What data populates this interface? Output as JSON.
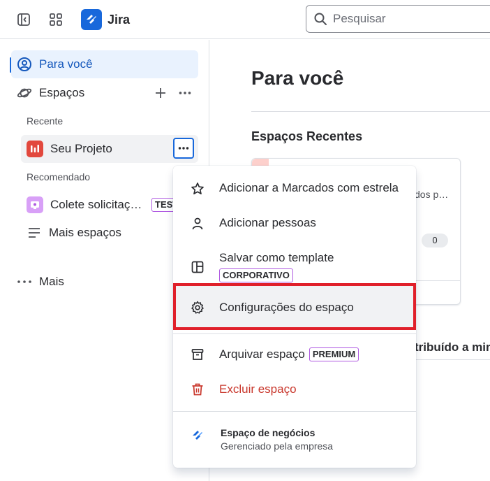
{
  "topbar": {
    "app_name": "Jira",
    "search_placeholder": "Pesquisar"
  },
  "sidebar": {
    "for_you": "Para você",
    "spaces": "Espaços",
    "recent_label": "Recente",
    "recent_project": "Seu Projeto",
    "recommended_label": "Recomendado",
    "recommended_item": "Colete solicitaç…",
    "recommended_tag": "TEST",
    "more_spaces": "Mais espaços",
    "more": "Mais"
  },
  "main": {
    "title": "Para você",
    "recent_spaces_title": "Espaços Recentes",
    "card_text": "dos p…",
    "card_count": "0",
    "assigned_partial": "tribuído a mim"
  },
  "menu": {
    "star": "Adicionar a Marcados com estrela",
    "add_people": "Adicionar pessoas",
    "save_template": "Salvar como template",
    "save_template_tag": "CORPORATIVO",
    "settings": "Configurações do espaço",
    "archive": "Arquivar espaço",
    "archive_tag": "PREMIUM",
    "delete": "Excluir espaço",
    "footer_title": "Espaço de negócios",
    "footer_subtitle": "Gerenciado pela empresa"
  },
  "colors": {
    "accent": "#1868db",
    "danger": "#c9372c",
    "highlight_frame": "#e0202a",
    "tag_border": "#af59e1"
  }
}
